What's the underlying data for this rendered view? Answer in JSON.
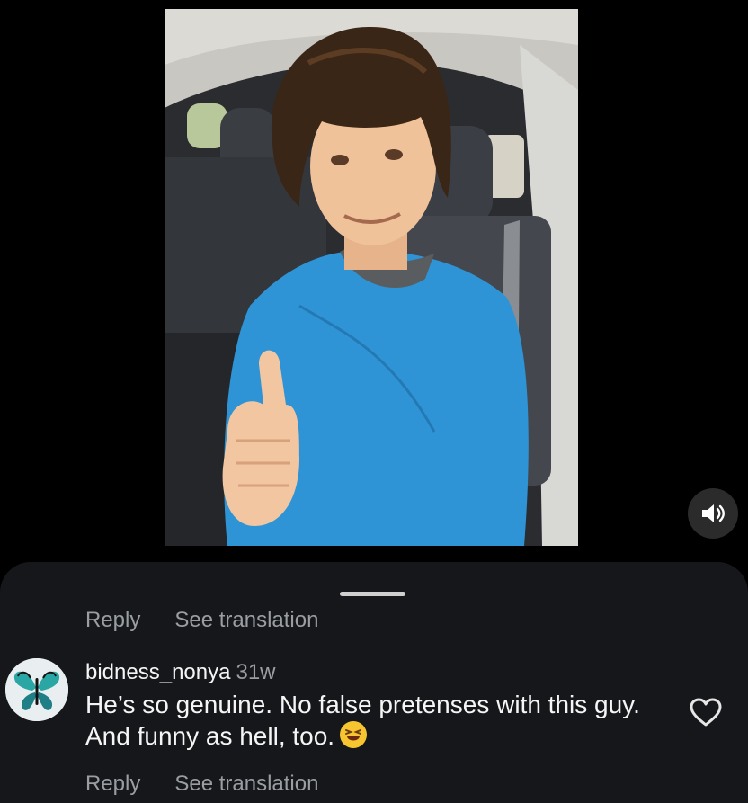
{
  "post": {
    "image_icon": "person-thumbs-up-photo",
    "mute_icon": "speaker-volume-icon"
  },
  "comments_sheet": {
    "prev_actions": {
      "reply": "Reply",
      "translate": "See translation"
    },
    "comment": {
      "username": "bidness_nonya",
      "age": "31w",
      "text": "He’s so genuine. No false pretenses with this guy. And funny as hell, too.",
      "avatar_icon": "butterfly-avatar",
      "emoji_icon": "laughing-face-emoji",
      "like_icon": "heart-icon"
    },
    "actions": {
      "reply": "Reply",
      "translate": "See translation"
    }
  },
  "colors": {
    "background": "#000000",
    "sheet": "#15171a",
    "muted_text": "#9a9ea3",
    "shirt_blue": "#2f94d6"
  }
}
